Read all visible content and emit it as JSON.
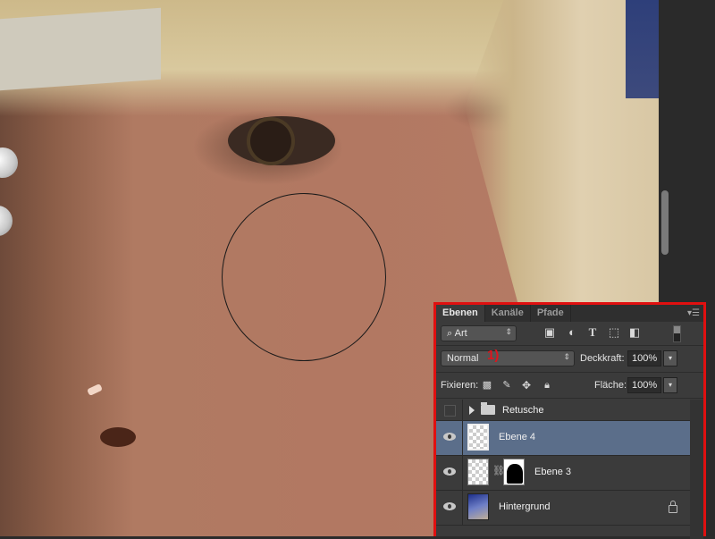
{
  "canvas": {
    "description": "close-up portrait retouching photo with circular brush cursor"
  },
  "layers_panel": {
    "tabs": [
      {
        "label": "Ebenen",
        "active": true
      },
      {
        "label": "Kanäle",
        "active": false
      },
      {
        "label": "Pfade",
        "active": false
      }
    ],
    "filter": {
      "kind_label": "Art",
      "icons": [
        "image-filter-icon",
        "adjustment-filter-icon",
        "type-filter-icon",
        "shape-filter-icon",
        "smart-object-filter-icon"
      ]
    },
    "blend_mode": "Normal",
    "annotation": "1)",
    "opacity_label": "Deckkraft:",
    "opacity_value": "100%",
    "lock_label": "Fixieren:",
    "fill_label": "Fläche:",
    "fill_value": "100%",
    "layers": [
      {
        "name": "Retusche",
        "type": "group",
        "visible": false,
        "expanded": false
      },
      {
        "name": "Ebene 4",
        "type": "pixel",
        "visible": true,
        "selected": true
      },
      {
        "name": "Ebene 3",
        "type": "pixel-with-mask",
        "visible": true
      },
      {
        "name": "Hintergrund",
        "type": "background",
        "visible": true,
        "locked": true
      }
    ],
    "accent_color": "#e01010",
    "selected_color": "#5b6e8a"
  }
}
